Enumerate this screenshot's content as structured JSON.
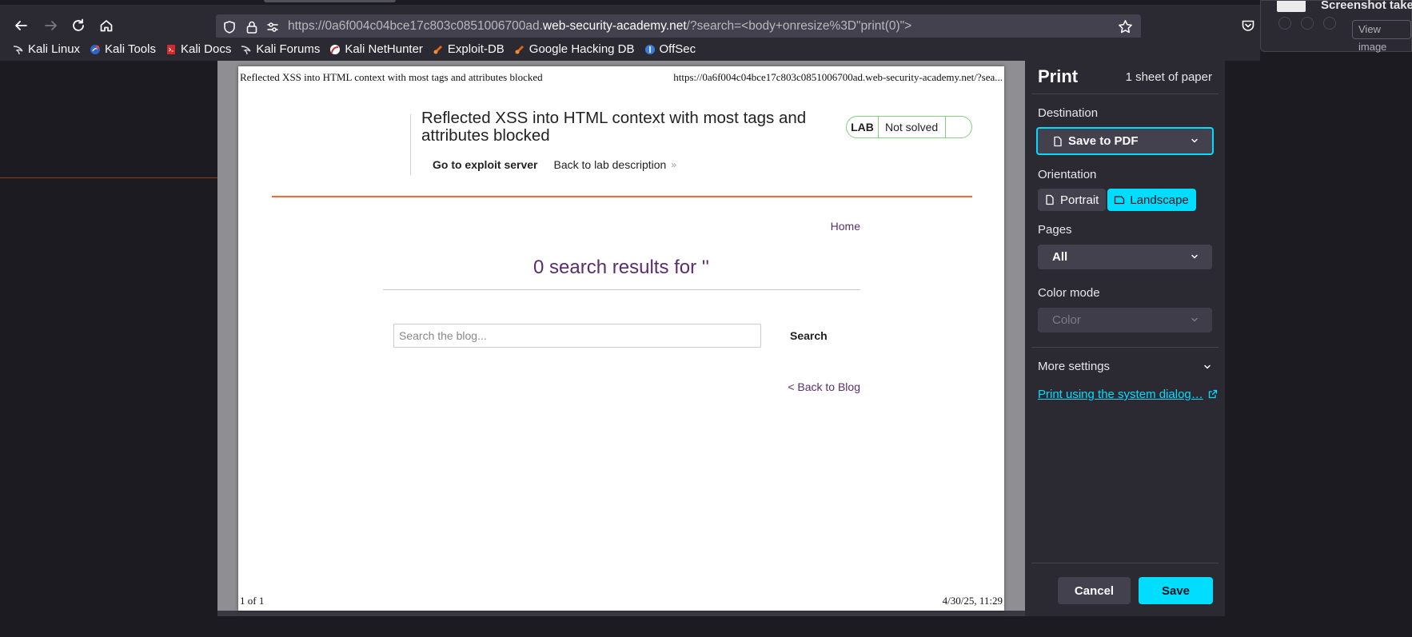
{
  "browser": {
    "url_prefix": "https://0a6f004c04bce17c803c0851006700ad.",
    "url_domain": "web-security-academy.net",
    "url_suffix": "/?search=<body+onresize%3D\"print(0)\">",
    "bookmarks": [
      {
        "label": "Kali Linux",
        "icon": "kali-dragon-icon"
      },
      {
        "label": "Kali Tools",
        "icon": "kali-tools-icon"
      },
      {
        "label": "Kali Docs",
        "icon": "kali-docs-icon"
      },
      {
        "label": "Kali Forums",
        "icon": "kali-dragon-icon"
      },
      {
        "label": "Kali NetHunter",
        "icon": "nethunter-icon"
      },
      {
        "label": "Exploit-DB",
        "icon": "exploit-db-icon"
      },
      {
        "label": "Google Hacking DB",
        "icon": "ghdb-icon"
      },
      {
        "label": "OffSec",
        "icon": "offsec-icon"
      }
    ]
  },
  "notification": {
    "title": "Screenshot taken",
    "view_button": "View image"
  },
  "preview": {
    "header_title": "Reflected XSS into HTML context with most tags and attributes blocked",
    "header_url": "https://0a6f004c04bce17c803c0851006700ad.web-security-academy.net/?sea...",
    "footer_page": "1 of 1",
    "footer_date": "4/30/25, 11:29",
    "lab_title": "Reflected XSS into HTML context with most tags and attributes blocked",
    "lab_badge": "LAB",
    "lab_status": "Not solved",
    "exploit_link": "Go to exploit server",
    "back_link": "Back to lab description",
    "home_link": "Home",
    "results_text": "0 search results for ''",
    "search_placeholder": "Search the blog...",
    "search_button": "Search",
    "back_to_blog": "< Back to Blog"
  },
  "print_panel": {
    "title": "Print",
    "sheets": "1 sheet of paper",
    "destination_label": "Destination",
    "destination_value": "Save to PDF",
    "orientation_label": "Orientation",
    "orientation_portrait": "Portrait",
    "orientation_landscape": "Landscape",
    "orientation_selected": "Landscape",
    "pages_label": "Pages",
    "pages_value": "All",
    "color_mode_label": "Color mode",
    "color_mode_value": "Color",
    "more_settings": "More settings",
    "system_dialog_link": "Print using the system dialog…",
    "cancel_button": "Cancel",
    "save_button": "Save",
    "accent_color": "#00ddff"
  }
}
